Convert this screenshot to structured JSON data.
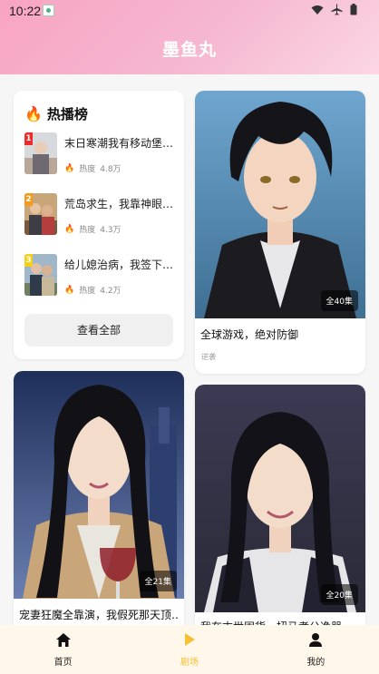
{
  "status_bar": {
    "time": "10:22"
  },
  "header": {
    "title": "墨鱼丸"
  },
  "hot_list": {
    "title": "热播榜",
    "heat_label": "热度",
    "items": [
      {
        "rank": "1",
        "name": "末日寒潮我有移动堡…",
        "heat": "4.8万",
        "rank_color": "#f02a2a"
      },
      {
        "rank": "2",
        "name": "荒岛求生，我靠神眼…",
        "heat": "4.3万",
        "rank_color": "#f59a1a"
      },
      {
        "rank": "3",
        "name": "给儿媳治病，我签下…",
        "heat": "4.2万",
        "rank_color": "#f5d01a"
      }
    ],
    "view_all": "查看全部"
  },
  "dramas": [
    {
      "title": "全球游戏，绝对防御",
      "tag": "逆袭",
      "episodes": "全40集"
    },
    {
      "title": "宠妻狂魔全靠演，我假死那天顶…",
      "episodes": "全21集"
    },
    {
      "title": "我在末世囤货，扭马孝公逸器",
      "episodes": "全20集"
    }
  ],
  "tabbar": {
    "items": [
      {
        "label": "首页"
      },
      {
        "label": "剧场"
      },
      {
        "label": "我的"
      }
    ],
    "active_color": "#f5c033"
  }
}
